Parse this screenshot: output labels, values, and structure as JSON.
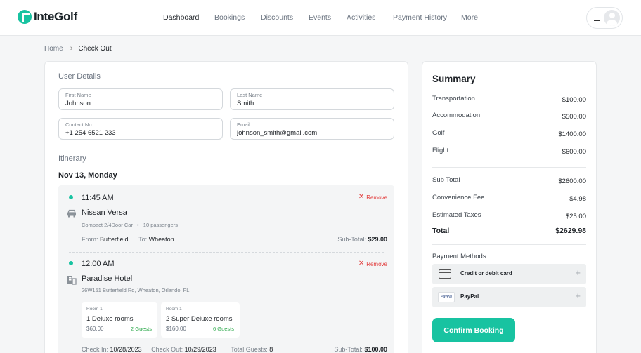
{
  "brand": {
    "name": "InteGolf",
    "accent": "#18c3a1"
  },
  "nav": {
    "items": [
      "Dashboard",
      "Bookings",
      "Discounts",
      "Events",
      "Activities",
      "Payment History",
      "More"
    ],
    "active": "Dashboard"
  },
  "breadcrumb": {
    "home": "Home",
    "current": "Check Out"
  },
  "user_details": {
    "title": "User Details",
    "first_name": {
      "label": "First Name",
      "value": "Johnson"
    },
    "last_name": {
      "label": "Last Name",
      "value": "Smith"
    },
    "contact": {
      "label": "Contact No.",
      "value": "+1 254 6521 233"
    },
    "email": {
      "label": "Email",
      "value": "johnson_smith@gmail.com"
    }
  },
  "itinerary": {
    "title": "Itinerary",
    "date": "Nov 13, Monday",
    "remove_label": "Remove",
    "transport": {
      "time": "11:45 AM",
      "name": "Nissan Versa",
      "type": "Compact 2/4Door Car",
      "bullet": "•",
      "passengers": "10 passengers",
      "from_label": "From:",
      "from": "Butterfield",
      "to_label": "To:",
      "to": "Wheaton",
      "subtotal_label": "Sub-Total:",
      "subtotal": "$29.00"
    },
    "hotel": {
      "time": "12:00 AM",
      "name": "Paradise Hotel",
      "address": "26W151 Butterfield Rd, Wheaton, Orlando, FL",
      "rooms": [
        {
          "label": "Room 1",
          "name": "1 Deluxe rooms",
          "price": "$60.00",
          "guests": "2 Guests"
        },
        {
          "label": "Room 1",
          "name": "2 Super Deluxe rooms",
          "price": "$160.00",
          "guests": "6 Guests"
        }
      ],
      "checkin_label": "Check In:",
      "checkin": "10/28/2023",
      "checkout_label": "Check Out:",
      "checkout": "10/29/2023",
      "guests_label": "Total Guests:",
      "guests": "8",
      "subtotal_label": "Sub-Total:",
      "subtotal": "$100.00"
    }
  },
  "summary": {
    "title": "Summary",
    "items": [
      {
        "label": "Transportation",
        "value": "$100.00"
      },
      {
        "label": "Accommodation",
        "value": "$500.00"
      },
      {
        "label": "Golf",
        "value": "$1400.00"
      },
      {
        "label": "Flight",
        "value": "$600.00"
      }
    ],
    "subtotal": {
      "label": "Sub Total",
      "value": "$2600.00"
    },
    "fee": {
      "label": "Convenience Fee",
      "value": "$4.98"
    },
    "taxes": {
      "label": "Estimated Taxes",
      "value": "$25.00"
    },
    "total": {
      "label": "Total",
      "value": "$2629.98"
    },
    "payment_title": "Payment Methods",
    "payment_methods": [
      {
        "label": "Credit or debit card",
        "icon": "credit-card-icon"
      },
      {
        "label": "PayPal",
        "icon": "paypal-icon",
        "icon_text": "PayPal"
      }
    ],
    "plus": "+",
    "confirm_label": "Confirm Booking"
  }
}
